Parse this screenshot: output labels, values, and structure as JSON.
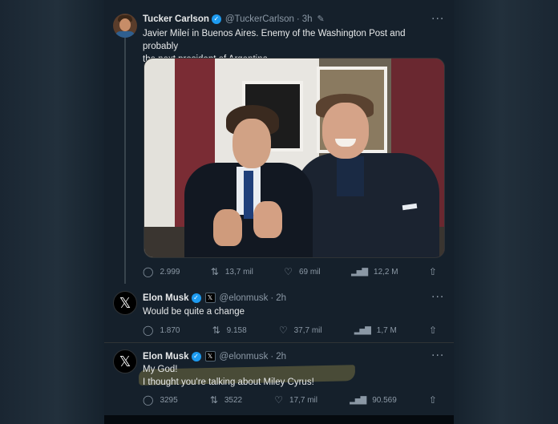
{
  "tweet1": {
    "name": "Tucker Carlson",
    "handle": "@TuckerCarlson",
    "separator": "·",
    "time": "3h",
    "text_line1": "Javier Mileí in Buenos Aires. Enemy of the Washington Post and probably",
    "text_line2": "the next president of Argentina.",
    "replies": "2.999",
    "reposts": "13,7 mil",
    "likes": "69 mil",
    "views": "12,2 M"
  },
  "tweet2": {
    "name": "Elon Musk",
    "handle": "@elonmusk",
    "separator": "·",
    "time": "2h",
    "text": "Would be quite a change",
    "replies": "1.870",
    "reposts": "9.158",
    "likes": "37,7 mil",
    "views": "1,7 M"
  },
  "tweet3": {
    "name": "Elon Musk",
    "handle": "@elonmusk",
    "separator": "·",
    "time": "2h",
    "text_line1": "My God!",
    "text_line2": "I thought you're talking about Miley Cyrus!",
    "replies": "3295",
    "reposts": "3522",
    "likes": "17,7 mil",
    "views": "90.569"
  },
  "icons": {
    "verified": "✓",
    "x_logo": "𝕏",
    "more": "···",
    "reply": "◯",
    "repost": "⇅",
    "like": "♡",
    "views": "▂▅▇",
    "share": "⇧",
    "edit": "✎"
  },
  "colors": {
    "background": "#15202b",
    "verified": "#1d9bf0",
    "secondary_text": "#8b98a5",
    "highlight": "#8a8046"
  }
}
